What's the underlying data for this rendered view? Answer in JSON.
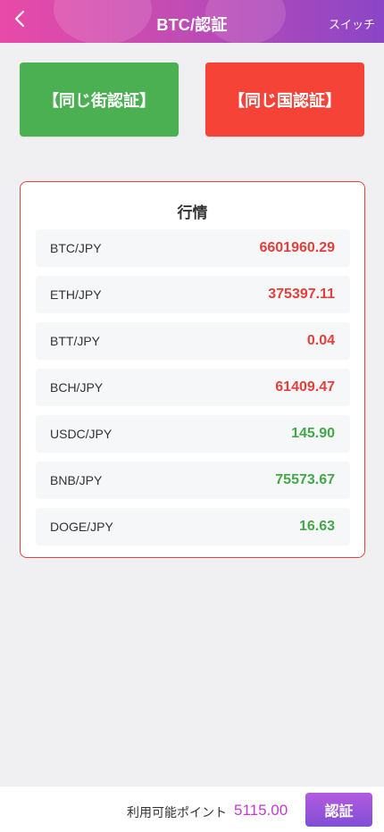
{
  "header": {
    "title": "BTC/認証",
    "switch_label": "スイッチ",
    "back_icon": "chevron-left-icon"
  },
  "auth_buttons": {
    "same_street_label": "【同じ街認証】",
    "same_street_color": "#4bb052",
    "same_country_label": "【同じ国認証】",
    "same_country_color": "#f54337"
  },
  "market": {
    "title": "行情",
    "rows": [
      {
        "pair": "BTC/JPY",
        "price": "6601960.29",
        "trend": "down"
      },
      {
        "pair": "ETH/JPY",
        "price": "375397.11",
        "trend": "down"
      },
      {
        "pair": "BTT/JPY",
        "price": "0.04",
        "trend": "down"
      },
      {
        "pair": "BCH/JPY",
        "price": "61409.47",
        "trend": "down"
      },
      {
        "pair": "USDC/JPY",
        "price": "145.90",
        "trend": "up"
      },
      {
        "pair": "BNB/JPY",
        "price": "75573.67",
        "trend": "up"
      },
      {
        "pair": "DOGE/JPY",
        "price": "16.63",
        "trend": "up"
      }
    ],
    "colors": {
      "down": "#e2403a",
      "up": "#44a848"
    }
  },
  "footer": {
    "points_label": "利用可能ポイント",
    "points_value": "5115.00",
    "verify_label": "認証"
  }
}
